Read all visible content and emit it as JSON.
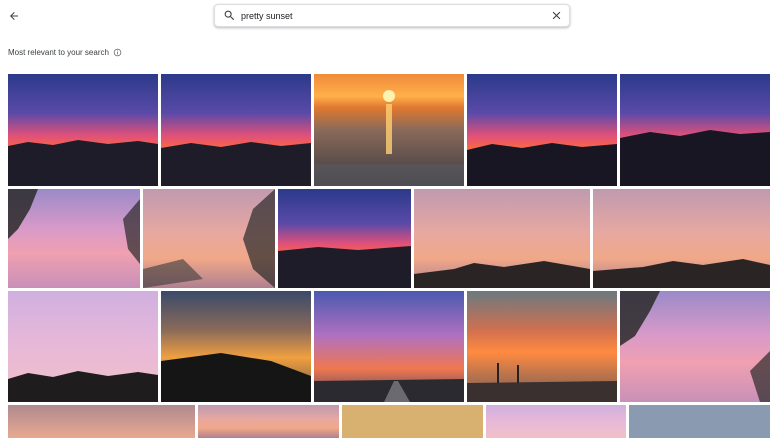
{
  "search": {
    "value": "pretty sunset",
    "back_icon": "arrow-left-icon",
    "search_icon": "magnifier-icon",
    "clear_icon": "close-icon"
  },
  "results": {
    "label": "Most relevant to your search",
    "info_icon": "info-icon"
  },
  "colors": {
    "accent": "#1a73e8",
    "text": "#202124",
    "muted": "#3c4043"
  }
}
